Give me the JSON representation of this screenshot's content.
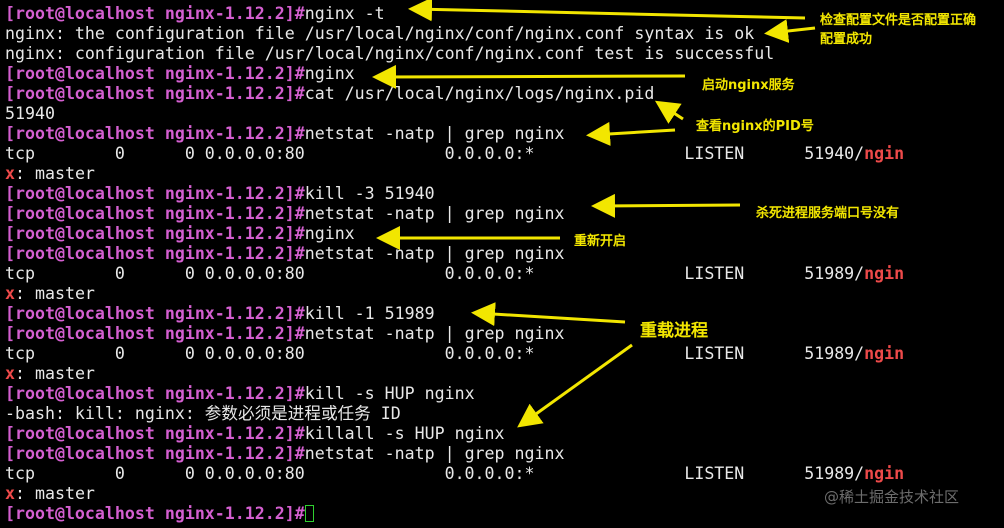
{
  "prompt": "[root@localhost nginx-1.12.2]#",
  "lines": [
    {
      "type": "cmd",
      "text": "nginx -t"
    },
    {
      "type": "out",
      "text": "nginx: the configuration file /usr/local/nginx/conf/nginx.conf syntax is ok"
    },
    {
      "type": "out",
      "text": "nginx: configuration file /usr/local/nginx/conf/nginx.conf test is successful"
    },
    {
      "type": "cmd",
      "text": "nginx"
    },
    {
      "type": "cmd",
      "text": "cat /usr/local/nginx/logs/nginx.pid"
    },
    {
      "type": "out",
      "text": "51940"
    },
    {
      "type": "cmd",
      "text": "netstat -natp | grep nginx"
    },
    {
      "type": "net",
      "text": "tcp        0      0 0.0.0.0:80              0.0.0.0:*               LISTEN      51940/",
      "red": "ngin"
    },
    {
      "type": "wrap",
      "red": "x",
      "text": ": master"
    },
    {
      "type": "cmd",
      "text": "kill -3 51940"
    },
    {
      "type": "cmd",
      "text": "netstat -natp | grep nginx"
    },
    {
      "type": "cmd",
      "text": "nginx"
    },
    {
      "type": "cmd",
      "text": "netstat -natp | grep nginx"
    },
    {
      "type": "net",
      "text": "tcp        0      0 0.0.0.0:80              0.0.0.0:*               LISTEN      51989/",
      "red": "ngin"
    },
    {
      "type": "wrap",
      "red": "x",
      "text": ": master"
    },
    {
      "type": "cmd",
      "text": "kill -1 51989"
    },
    {
      "type": "cmd",
      "text": "netstat -natp | grep nginx"
    },
    {
      "type": "net",
      "text": "tcp        0      0 0.0.0.0:80              0.0.0.0:*               LISTEN      51989/",
      "red": "ngin"
    },
    {
      "type": "wrap",
      "red": "x",
      "text": ": master"
    },
    {
      "type": "cmd",
      "text": "kill -s HUP nginx"
    },
    {
      "type": "out",
      "text": "-bash: kill: nginx: 参数必须是进程或任务 ID"
    },
    {
      "type": "cmd",
      "text": "killall -s HUP nginx"
    },
    {
      "type": "cmd",
      "text": "netstat -natp | grep nginx"
    },
    {
      "type": "net",
      "text": "tcp        0      0 0.0.0.0:80              0.0.0.0:*               LISTEN      51989/",
      "red": "ngin"
    },
    {
      "type": "wrap",
      "red": "x",
      "text": ": master"
    },
    {
      "type": "input",
      "text": ""
    }
  ],
  "annotations": {
    "check_config_1": "检查配置文件是否配置正确",
    "check_config_2": "配置成功",
    "start": "启动nginx服务",
    "pid": "查看nginx的PID号",
    "kill": "杀死进程服务端口号没有",
    "restart": "重新开启",
    "reload": "重载进程"
  },
  "watermark": "@稀土掘金技术社区",
  "colors": {
    "prompt": "#d45fd0",
    "highlight": "#ee4a4a",
    "annotation": "#f2e600",
    "cursor": "#2fd02f"
  }
}
